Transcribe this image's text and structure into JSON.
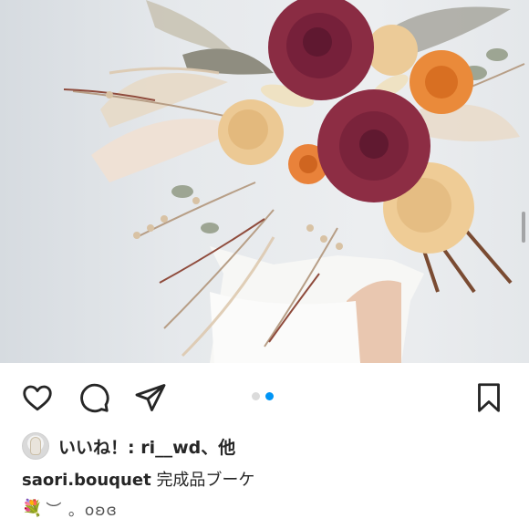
{
  "post": {
    "photo_alt": "",
    "carousel": {
      "count": 2,
      "active_index": 1
    }
  },
  "colors": {
    "text": "#262626",
    "carousel_active": "#0095f6",
    "carousel_inactive": "#dbdbdb"
  },
  "actions": {
    "like_icon": "heart-icon",
    "comment_icon": "comment-icon",
    "share_icon": "send-icon",
    "save_icon": "bookmark-icon"
  },
  "likes": {
    "prefix": "いいね！: ",
    "username": "ri__wd",
    "suffix": "、他"
  },
  "caption": {
    "username": "saori.bouquet",
    "text": "完成品ブーケ",
    "emoji": "💐",
    "tail": "︶ 。oʚɞ"
  }
}
